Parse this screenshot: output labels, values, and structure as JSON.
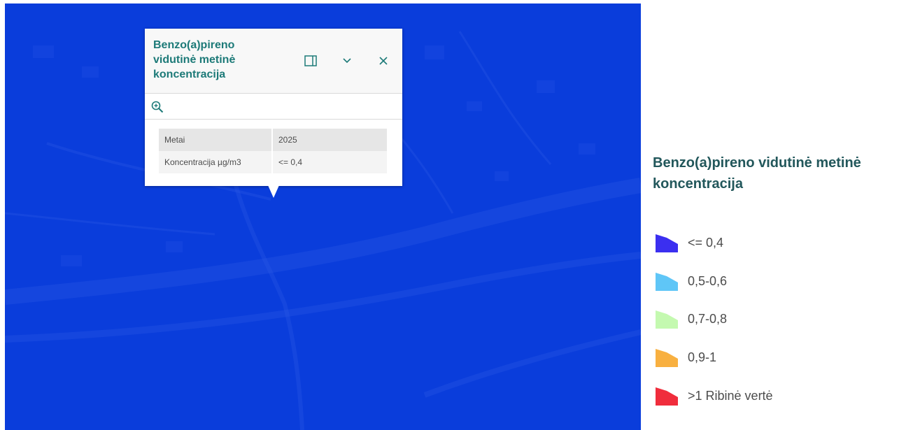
{
  "popup": {
    "title_lines": [
      "Benzo(a)pireno",
      "vidutinė metinė",
      "koncentracija"
    ],
    "rows": [
      {
        "field": "Metai",
        "value": "2025"
      },
      {
        "field": "Koncentracija µg/m3",
        "value": "<= 0,4"
      }
    ],
    "icons": {
      "dock": "dock-icon",
      "collapse": "chevron-down-icon",
      "close": "close-icon",
      "zoom": "zoom-in-icon"
    }
  },
  "legend": {
    "title_lines": [
      "Benzo(a)pireno vidutinė metinė",
      "koncentracija"
    ],
    "items": [
      {
        "label": "<= 0,4",
        "color": "#3b2ff0"
      },
      {
        "label": "0,5-0,6",
        "color": "#5fc6f7"
      },
      {
        "label": "0,7-0,8",
        "color": "#c4f9b0"
      },
      {
        "label": "0,9-1",
        "color": "#f8b040"
      },
      {
        "label": ">1 Ribinė vertė",
        "color": "#f02d3c"
      }
    ]
  },
  "colors": {
    "map_fill": "#0a3ddb",
    "accent": "#1d7a78"
  }
}
